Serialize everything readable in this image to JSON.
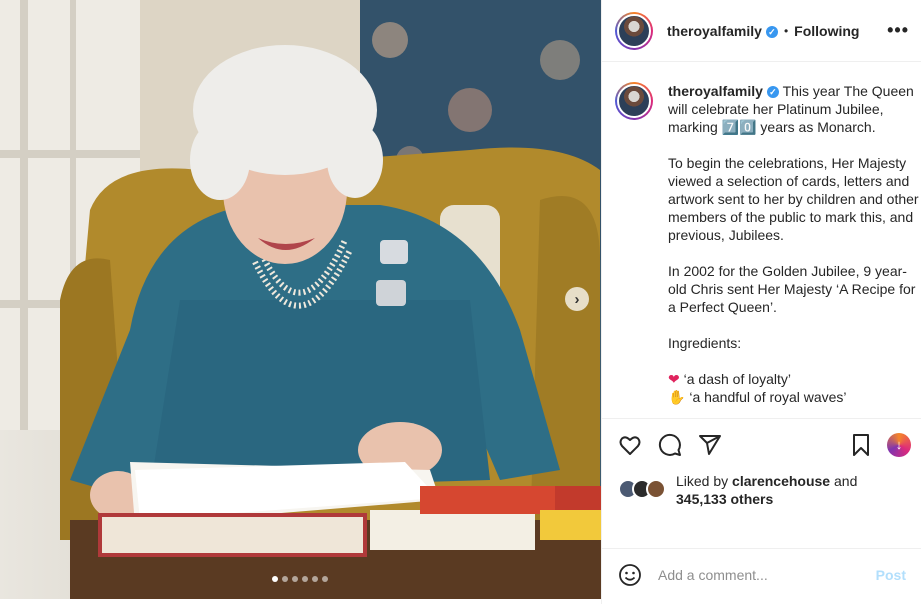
{
  "post": {
    "username": "theroyalfamily",
    "separator": "•",
    "follow_status": "Following",
    "more_label": "•••",
    "caption": {
      "username": "theroyalfamily",
      "text": " This year The Queen will celebrate her Platinum Jubilee, marking 7️⃣0️⃣ years as Monarch.\n\nTo begin the celebrations, Her Majesty viewed a selection of cards, letters and artwork sent to her by children and other members of the public to mark this, and previous, Jubilees.\n\nIn 2002 for the Golden Jubilee, 9 year-old Chris sent Her Majesty ‘A Recipe for a Perfect Queen’.\n\nIngredients:\n\n",
      "ingredient_1": " ‘a dash of loyalty’",
      "ingredient_2": " ‘a handful of royal waves’"
    },
    "likes": {
      "prefix": "Liked by ",
      "liker": "clarencehouse",
      "middle": " and ",
      "count": "345,133 others"
    },
    "comment": {
      "placeholder": "Add a comment...",
      "post_label": "Post"
    },
    "carousel": {
      "next_label": "›",
      "slide_count": 6,
      "current_slide": 1
    }
  },
  "colors": {
    "accent": "#3897f0",
    "verified": "#3897f0",
    "post_disabled": "#b2dffc"
  }
}
